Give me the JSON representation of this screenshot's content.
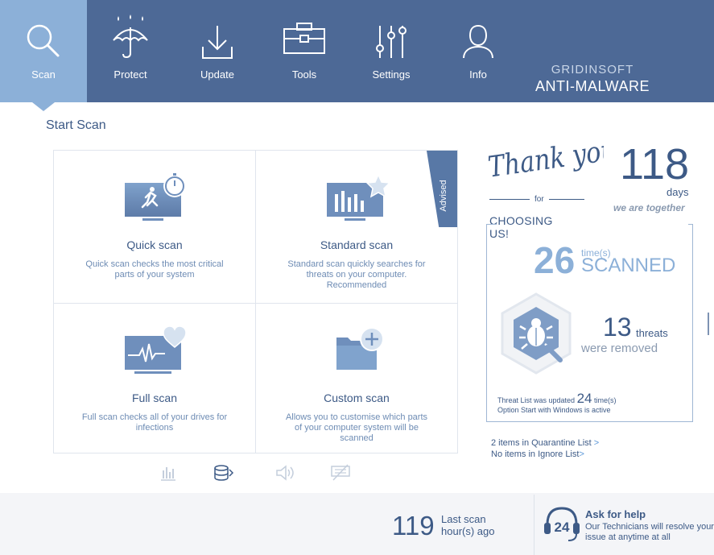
{
  "nav": {
    "items": [
      {
        "label": "Scan",
        "icon": "search-icon"
      },
      {
        "label": "Protect",
        "icon": "umbrella-icon"
      },
      {
        "label": "Update",
        "icon": "download-icon"
      },
      {
        "label": "Tools",
        "icon": "toolbox-icon"
      },
      {
        "label": "Settings",
        "icon": "sliders-icon"
      },
      {
        "label": "Info",
        "icon": "user-icon"
      }
    ],
    "active_index": 0,
    "brand_top": "GRIDINSOFT",
    "brand_bottom": "ANTI-MALWARE"
  },
  "page": {
    "heading": "Start Scan"
  },
  "scans": [
    {
      "title": "Quick scan",
      "desc": "Quick scan checks the most critical parts of your system",
      "icon": "quick-scan-icon"
    },
    {
      "title": "Standard scan",
      "desc": "Standard scan quickly searches for threats on your computer. Recommended",
      "icon": "standard-scan-icon",
      "badge": "Advised"
    },
    {
      "title": "Full scan",
      "desc": "Full scan checks all of your drives for infections",
      "icon": "full-scan-icon"
    },
    {
      "title": "Custom scan",
      "desc": "Allows you to customise which parts of your computer system will be scanned",
      "icon": "custom-scan-icon"
    }
  ],
  "toolbar_icons": [
    "chart-icon",
    "database-icon",
    "speaker-icon",
    "network-icon"
  ],
  "thanks": {
    "script": "Thank you",
    "for": "for",
    "choosing": "CHOOSING US!"
  },
  "days": {
    "value": "118",
    "label": "days",
    "tagline": "we are together"
  },
  "scanned": {
    "value": "26",
    "small": "time(s)",
    "big": "SCANNED"
  },
  "threats": {
    "value": "13",
    "label": "threats",
    "removed": "were removed"
  },
  "threatlist": {
    "prefix": "Threat List was updated",
    "count": "24",
    "suffix": "time(s)",
    "option": "Option Start with Windows is active"
  },
  "quarantine": {
    "text": "2 items in Quarantine List",
    "arrow": ">"
  },
  "ignore": {
    "text": "No items in Ignore List",
    "arrow": ">"
  },
  "last_scan": {
    "value": "119",
    "line1": "Last scan",
    "line2": "hour(s) ago"
  },
  "help": {
    "title": "Ask for help",
    "desc": "Our Technicians will resolve your issue at anytime at all",
    "badge": "24"
  },
  "colors": {
    "nav_bg": "#4d6996",
    "nav_active": "#8cb0d8",
    "text": "#3d5a86",
    "accent_light": "#8cb0d8"
  }
}
